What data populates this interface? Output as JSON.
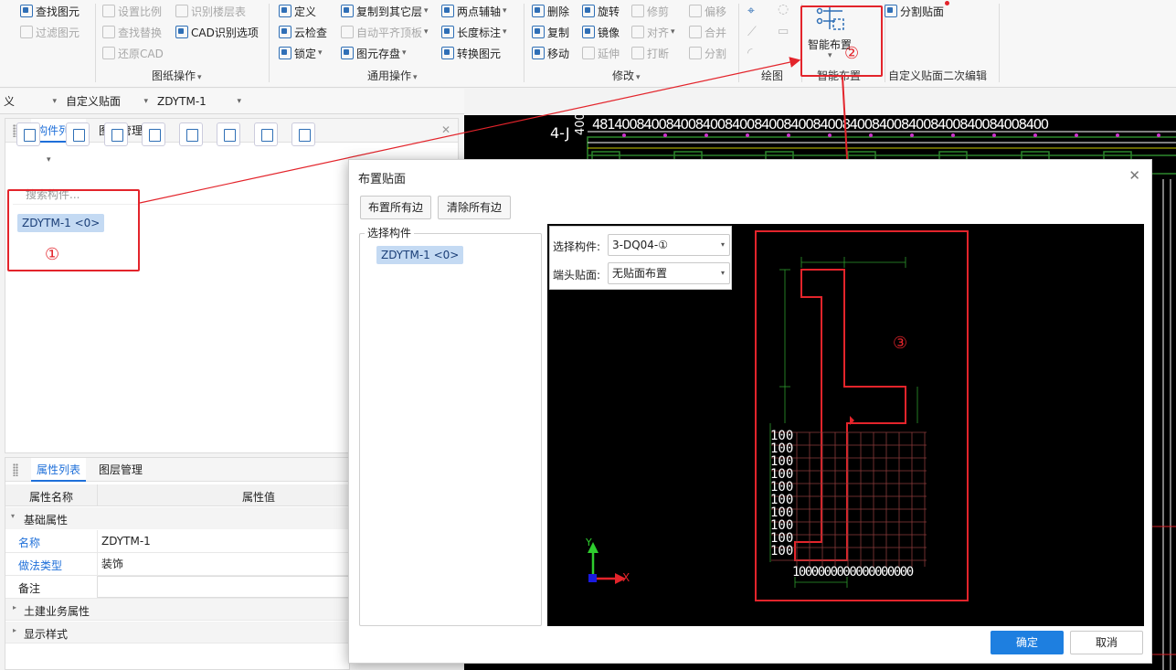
{
  "ribbon": {
    "g1": {
      "find": "查找图元",
      "filter": "过滤图元"
    },
    "g2": {
      "scale": "设置比例",
      "find_replace": "查找替换",
      "restore": "还原CAD",
      "identify_floor": "识别楼层表",
      "cad_options": "CAD识别选项",
      "label": "图纸操作"
    },
    "g3": {
      "define": "定义",
      "cloud_check": "云检查",
      "lock": "锁定",
      "copy_other": "复制到其它层",
      "auto_flat": "自动平齐顶板",
      "save_elem": "图元存盘",
      "two_point_axis": "两点辅轴",
      "length_mark": "长度标注",
      "convert": "转换图元",
      "label": "通用操作"
    },
    "g4": {
      "delete": "删除",
      "copy": "复制",
      "move": "移动",
      "rotate": "旋转",
      "mirror": "镜像",
      "extend": "延伸",
      "trim": "修剪",
      "align": "对齐",
      "break": "打断",
      "offset": "偏移",
      "merge": "合并",
      "split": "分割",
      "label": "修改"
    },
    "g5": {
      "label": "绘图"
    },
    "g6": {
      "smart_layout": "智能布置",
      "label": "智能布置"
    },
    "g7": {
      "split_face": "分割贴面",
      "label": "自定义贴面二次编辑"
    }
  },
  "bar2": {
    "c0": "义",
    "c1": "自定义贴面",
    "c2": "ZDYTM-1"
  },
  "left_panel": {
    "tab1": "构件列表",
    "tab2": "图纸管理",
    "search_placeholder": "搜索构件...",
    "item": "ZDYTM-1 <0>"
  },
  "props_panel": {
    "tab1": "属性列表",
    "tab2": "图层管理",
    "col_name": "属性名称",
    "col_value": "属性值",
    "section_basic": "基础属性",
    "rows": [
      {
        "k": "名称",
        "v": "ZDYTM-1"
      },
      {
        "k": "做法类型",
        "v": "装饰"
      },
      {
        "k": "备注",
        "v": ""
      }
    ],
    "section_civil": "土建业务属性",
    "section_display": "显示样式"
  },
  "annotations": {
    "n1": "①",
    "n2": "②",
    "n3": "③"
  },
  "cad": {
    "axis_label": "4-J",
    "top_numbers": "48140084008400840084008400840084008400840084008400840084008400",
    "left_num": "400"
  },
  "dialog": {
    "title": "布置贴面",
    "btn_all": "布置所有边",
    "btn_clear": "清除所有边",
    "group_label": "选择构件",
    "item": "ZDYTM-1 <0>",
    "select_label": "选择构件:",
    "select_value": "3-DQ04-①",
    "end_label": "端头贴面:",
    "end_value": "无贴面布置",
    "grid_labels": [
      "100",
      "100",
      "100",
      "100",
      "100",
      "100",
      "100",
      "100",
      "100",
      "100"
    ],
    "bottom_label": "1000000000000000000",
    "y_axis": "Y",
    "x_axis": "X",
    "ok": "确定",
    "cancel": "取消"
  },
  "colors": {
    "accent": "#1e6fd9",
    "annotation_red": "#e3242b",
    "cad_bg": "#000000"
  }
}
